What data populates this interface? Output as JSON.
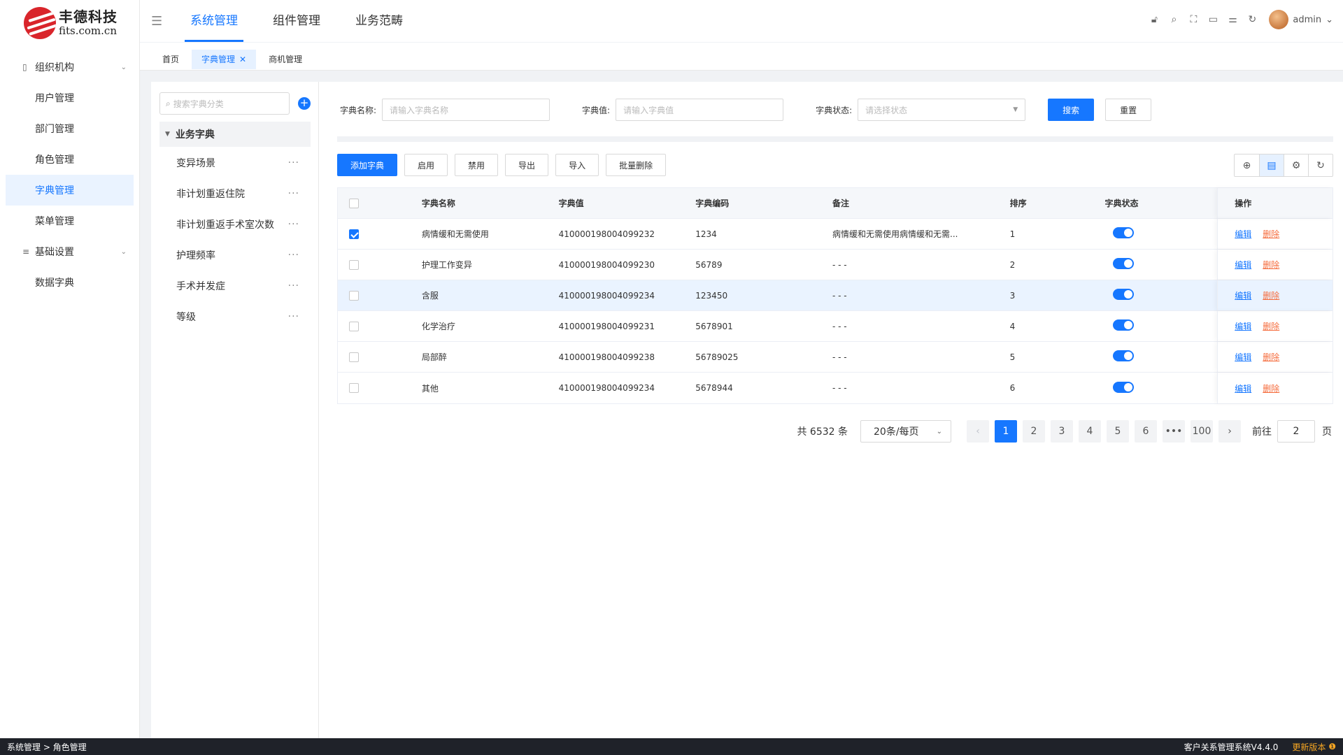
{
  "brand": {
    "name": "丰德科技",
    "domain": "fits.com.cn"
  },
  "sidebar": {
    "groups": [
      {
        "label": "组织机构",
        "items": [
          "用户管理",
          "部门管理",
          "角色管理",
          "字典管理",
          "菜单管理"
        ]
      },
      {
        "label": "基础设置",
        "items": [
          "数据字典"
        ]
      }
    ],
    "active_item": "字典管理"
  },
  "header": {
    "nav": [
      "系统管理",
      "组件管理",
      "业务范畴"
    ],
    "active_nav": "系统管理",
    "user": "admin"
  },
  "tabs": [
    {
      "label": "首页",
      "active": false
    },
    {
      "label": "字典管理",
      "active": true
    },
    {
      "label": "商机管理",
      "active": false
    }
  ],
  "tree": {
    "search_placeholder": "搜索字典分类",
    "root": "业务字典",
    "nodes": [
      "变异场景",
      "非计划重返住院",
      "非计划重返手术室次数",
      "护理频率",
      "手术并发症",
      "等级"
    ]
  },
  "filter": {
    "name_label": "字典名称:",
    "name_placeholder": "请输入字典名称",
    "value_label": "字典值:",
    "value_placeholder": "请输入字典值",
    "status_label": "字典状态:",
    "status_placeholder": "请选择状态",
    "search": "搜索",
    "reset": "重置"
  },
  "toolbar": {
    "add": "添加字典",
    "enable": "启用",
    "disable": "禁用",
    "export": "导出",
    "import": "导入",
    "batch_delete": "批量删除"
  },
  "table": {
    "headers": [
      "字典名称",
      "字典值",
      "字典编码",
      "备注",
      "排序",
      "字典状态",
      "操作"
    ],
    "rows": [
      {
        "name": "病情缓和无需使用",
        "value": "410000198004099232",
        "code": "1234",
        "note": "病情缓和无需使用病情缓和无需...",
        "order": "1",
        "checked": true,
        "status_on": true
      },
      {
        "name": "护理工作变异",
        "value": "410000198004099230",
        "code": "56789",
        "note": "- - -",
        "order": "2",
        "checked": false,
        "status_on": true
      },
      {
        "name": "含服",
        "value": "410000198004099234",
        "code": "123450",
        "note": "- - -",
        "order": "3",
        "checked": false,
        "status_on": true
      },
      {
        "name": "化学治疗",
        "value": "410000198004099231",
        "code": "5678901",
        "note": "- - -",
        "order": "4",
        "checked": false,
        "status_on": true
      },
      {
        "name": "局部醉",
        "value": "410000198004099238",
        "code": "56789025",
        "note": "- - -",
        "order": "5",
        "checked": false,
        "status_on": true
      },
      {
        "name": "其他",
        "value": "410000198004099234",
        "code": "5678944",
        "note": "- - -",
        "order": "6",
        "checked": false,
        "status_on": true
      }
    ],
    "highlight_row": 2,
    "edit": "编辑",
    "delete": "删除"
  },
  "pagination": {
    "total": "共 6532 条",
    "page_size": "20条/每页",
    "pages": [
      "1",
      "2",
      "3",
      "4",
      "5",
      "6"
    ],
    "ellipsis": "•••",
    "last": "100",
    "current": "1",
    "goto_label": "前往",
    "goto_value": "2",
    "page_suffix": "页"
  },
  "footer": {
    "breadcrumb": "系统管理 > 角色管理",
    "version": "客户关系管理系统V4.4.0",
    "update": "更新版本"
  },
  "colors": {
    "primary": "#1677ff",
    "danger": "#f56c3d",
    "footer_bg": "#1f2229"
  }
}
